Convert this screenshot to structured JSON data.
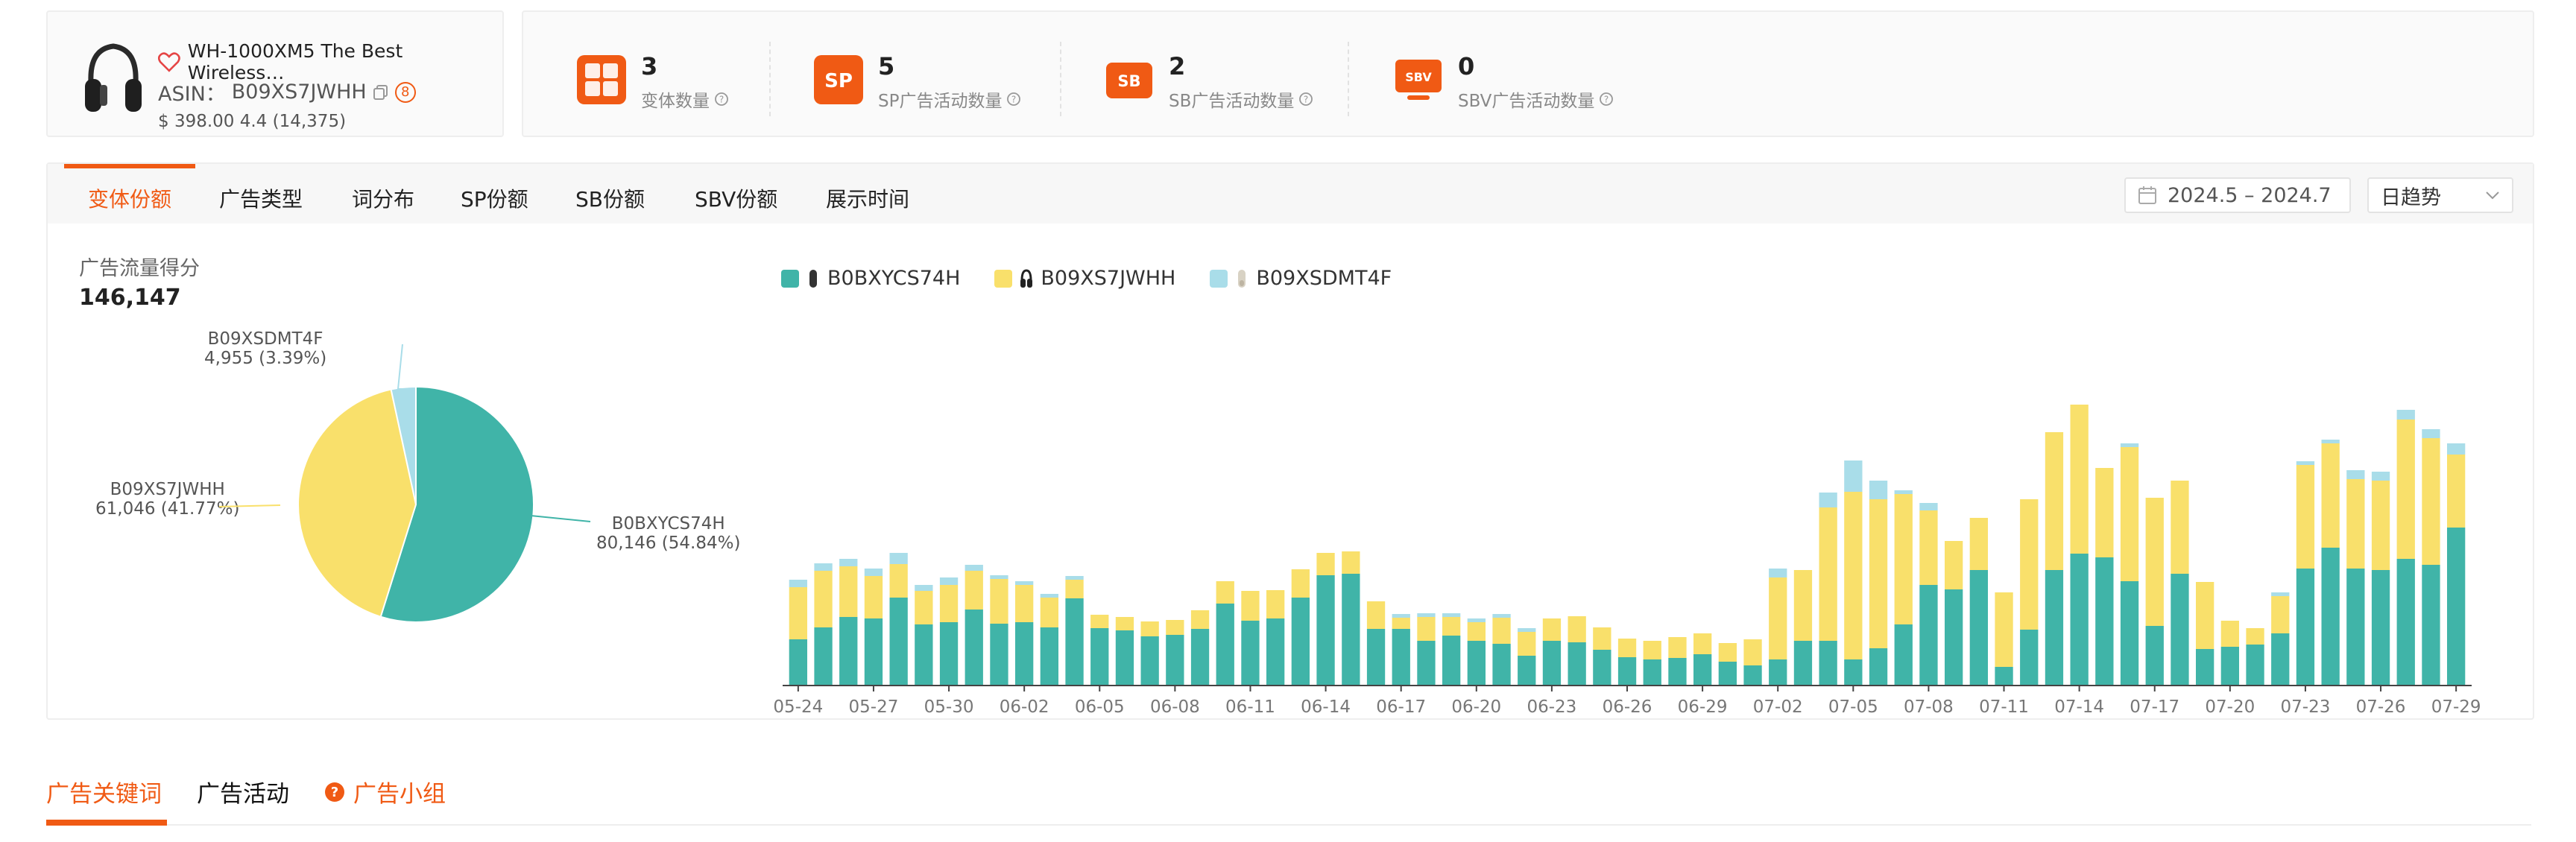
{
  "product": {
    "title": "WH-1000XM5 The Best Wireless…",
    "asin_label": "ASIN：",
    "asin": "B09XS7JWHH",
    "badge": "8",
    "price_rating": "$ 398.00  4.4  (14,375)"
  },
  "metrics": [
    {
      "value": "3",
      "label": "变体数量",
      "icon": "grid-icon",
      "icon_text": ""
    },
    {
      "value": "5",
      "label": "SP广告活动数量",
      "icon": "sp-icon",
      "icon_text": "SP"
    },
    {
      "value": "2",
      "label": "SB广告活动数量",
      "icon": "sb-icon",
      "icon_text": "SB"
    },
    {
      "value": "0",
      "label": "SBV广告活动数量",
      "icon": "sbv-icon",
      "icon_text": "SBV"
    }
  ],
  "tabs": [
    "变体份额",
    "广告类型",
    "词分布",
    "SP份额",
    "SB份额",
    "SBV份额",
    "展示时间"
  ],
  "active_tab": 0,
  "date_range": "2024.5 – 2024.7",
  "trend_select": "日趋势",
  "score": {
    "title": "广告流量得分",
    "value": "146,147"
  },
  "colors": {
    "teal": "#40b4a8",
    "yellow": "#f9e06b",
    "blue": "#a9dde9",
    "accent": "#f05a14"
  },
  "pie": {
    "slices": [
      {
        "name": "B0BXYCS74H",
        "value": 80146,
        "label": "B0BXYCS74H",
        "sublabel": "80,146 (54.84%)",
        "color": "#40b4a8"
      },
      {
        "name": "B09XS7JWHH",
        "value": 61046,
        "label": "B09XS7JWHH",
        "sublabel": "61,046 (41.77%)",
        "color": "#f9e06b"
      },
      {
        "name": "B09XSDMT4F",
        "value": 4955,
        "label": "B09XSDMT4F",
        "sublabel": "4,955 (3.39%)",
        "color": "#a9dde9"
      }
    ]
  },
  "legend": [
    {
      "name": "B0BXYCS74H",
      "color": "#40b4a8"
    },
    {
      "name": "B09XS7JWHH",
      "color": "#f9e06b"
    },
    {
      "name": "B09XSDMT4F",
      "color": "#a9dde9"
    }
  ],
  "chart_data": {
    "type": "bar",
    "stacked": true,
    "xtick_labels": [
      "05-24",
      "05-27",
      "05-30",
      "06-02",
      "06-05",
      "06-08",
      "06-11",
      "06-14",
      "06-17",
      "06-20",
      "06-23",
      "06-26",
      "06-29",
      "07-02",
      "07-05",
      "07-08",
      "07-11",
      "07-14",
      "07-17",
      "07-20",
      "07-23",
      "07-26",
      "07-29"
    ],
    "categories": [
      "05-24",
      "05-25",
      "05-26",
      "05-27",
      "05-28",
      "05-29",
      "05-30",
      "05-31",
      "06-01",
      "06-02",
      "06-03",
      "06-04",
      "06-05",
      "06-06",
      "06-07",
      "06-08",
      "06-09",
      "06-10",
      "06-11",
      "06-12",
      "06-13",
      "06-14",
      "06-15",
      "06-16",
      "06-17",
      "06-18",
      "06-19",
      "06-20",
      "06-21",
      "06-22",
      "06-23",
      "06-24",
      "06-25",
      "06-26",
      "06-27",
      "06-28",
      "06-29",
      "06-30",
      "07-01",
      "07-02",
      "07-03",
      "07-04",
      "07-05",
      "07-06",
      "07-07",
      "07-08",
      "07-09",
      "07-10",
      "07-11",
      "07-12",
      "07-13",
      "07-14",
      "07-15",
      "07-16",
      "07-17",
      "07-18",
      "07-19",
      "07-20",
      "07-21",
      "07-22",
      "07-23",
      "07-24",
      "07-25",
      "07-26",
      "07-27",
      "07-28",
      "07-29"
    ],
    "series": [
      {
        "name": "B0BXYCS74H",
        "color": "#40b4a8",
        "values": [
          62,
          78,
          92,
          90,
          118,
          82,
          85,
          102,
          83,
          85,
          78,
          117,
          77,
          74,
          66,
          68,
          76,
          110,
          87,
          90,
          118,
          148,
          150,
          76,
          76,
          60,
          67,
          60,
          56,
          40,
          60,
          58,
          48,
          38,
          35,
          37,
          42,
          32,
          27,
          35,
          60,
          60,
          35,
          50,
          82,
          135,
          129,
          155,
          25,
          75,
          155,
          177,
          172,
          140,
          80,
          150,
          49,
          52,
          55,
          70,
          157,
          185,
          157,
          155,
          170,
          162,
          212
        ]
      },
      {
        "name": "B09XS7JWHH",
        "color": "#f9e06b",
        "values": [
          70,
          76,
          68,
          57,
          45,
          45,
          50,
          52,
          60,
          50,
          40,
          25,
          18,
          18,
          20,
          20,
          25,
          30,
          40,
          38,
          38,
          30,
          30,
          37,
          15,
          32,
          25,
          25,
          35,
          32,
          30,
          35,
          30,
          25,
          25,
          28,
          28,
          25,
          35,
          110,
          95,
          179,
          225,
          200,
          175,
          100,
          65,
          70,
          100,
          175,
          185,
          200,
          120,
          180,
          172,
          125,
          90,
          35,
          22,
          50,
          139,
          140,
          120,
          120,
          187,
          170,
          98
        ]
      },
      {
        "name": "B09XSDMT4F",
        "color": "#a9dde9",
        "values": [
          10,
          10,
          10,
          10,
          15,
          8,
          10,
          8,
          5,
          5,
          5,
          5,
          0,
          0,
          0,
          0,
          0,
          0,
          0,
          0,
          0,
          0,
          0,
          0,
          5,
          5,
          5,
          5,
          5,
          5,
          0,
          0,
          0,
          0,
          0,
          0,
          0,
          0,
          0,
          12,
          0,
          20,
          42,
          25,
          5,
          10,
          0,
          0,
          0,
          0,
          0,
          0,
          0,
          5,
          0,
          0,
          0,
          0,
          0,
          5,
          5,
          5,
          12,
          12,
          13,
          12,
          15
        ]
      }
    ]
  },
  "bottom_tabs": [
    {
      "label": "广告关键词",
      "active": true
    },
    {
      "label": "广告活动",
      "active": false
    },
    {
      "label": "广告小组",
      "active": false,
      "icon": "question-icon"
    }
  ]
}
